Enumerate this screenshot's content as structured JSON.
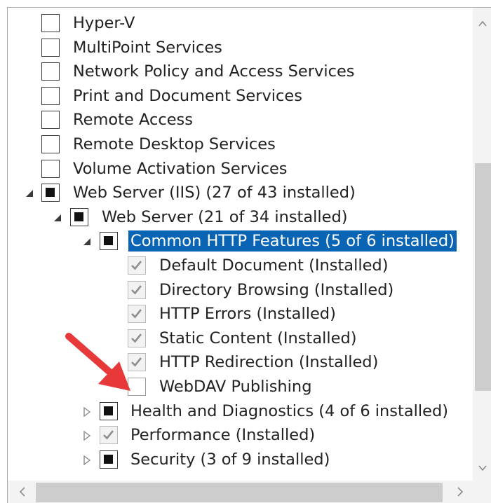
{
  "tree": {
    "rows": [
      {
        "label": "Hyper-V",
        "state": "unchecked",
        "disabled": false,
        "expander": "none",
        "level": 0,
        "selected": false
      },
      {
        "label": "MultiPoint Services",
        "state": "unchecked",
        "disabled": false,
        "expander": "none",
        "level": 0,
        "selected": false
      },
      {
        "label": "Network Policy and Access Services",
        "state": "unchecked",
        "disabled": false,
        "expander": "none",
        "level": 0,
        "selected": false
      },
      {
        "label": "Print and Document Services",
        "state": "unchecked",
        "disabled": false,
        "expander": "none",
        "level": 0,
        "selected": false
      },
      {
        "label": "Remote Access",
        "state": "unchecked",
        "disabled": false,
        "expander": "none",
        "level": 0,
        "selected": false
      },
      {
        "label": "Remote Desktop Services",
        "state": "unchecked",
        "disabled": false,
        "expander": "none",
        "level": 0,
        "selected": false
      },
      {
        "label": "Volume Activation Services",
        "state": "unchecked",
        "disabled": false,
        "expander": "none",
        "level": 0,
        "selected": false
      },
      {
        "label": "Web Server (IIS) (27 of 43 installed)",
        "state": "indeterminate",
        "disabled": false,
        "expander": "expanded",
        "level": 0,
        "selected": false
      },
      {
        "label": "Web Server (21 of 34 installed)",
        "state": "indeterminate",
        "disabled": false,
        "expander": "expanded",
        "level": 1,
        "selected": false
      },
      {
        "label": "Common HTTP Features (5 of 6 installed)",
        "state": "indeterminate",
        "disabled": false,
        "expander": "expanded",
        "level": 2,
        "selected": true
      },
      {
        "label": "Default Document (Installed)",
        "state": "checked",
        "disabled": true,
        "expander": "none",
        "level": 3,
        "selected": false
      },
      {
        "label": "Directory Browsing (Installed)",
        "state": "checked",
        "disabled": true,
        "expander": "none",
        "level": 3,
        "selected": false
      },
      {
        "label": "HTTP Errors (Installed)",
        "state": "checked",
        "disabled": true,
        "expander": "none",
        "level": 3,
        "selected": false
      },
      {
        "label": "Static Content (Installed)",
        "state": "checked",
        "disabled": true,
        "expander": "none",
        "level": 3,
        "selected": false
      },
      {
        "label": "HTTP Redirection (Installed)",
        "state": "checked",
        "disabled": true,
        "expander": "none",
        "level": 3,
        "selected": false
      },
      {
        "label": "WebDAV Publishing",
        "state": "unchecked",
        "disabled": true,
        "expander": "none",
        "level": 3,
        "selected": false
      },
      {
        "label": "Health and Diagnostics (4 of 6 installed)",
        "state": "indeterminate",
        "disabled": false,
        "expander": "collapsed",
        "level": 2,
        "selected": false
      },
      {
        "label": "Performance (Installed)",
        "state": "checked",
        "disabled": true,
        "expander": "collapsed",
        "level": 2,
        "selected": false
      },
      {
        "label": "Security (3 of 9 installed)",
        "state": "indeterminate",
        "disabled": false,
        "expander": "collapsed",
        "level": 2,
        "selected": false
      }
    ]
  },
  "icons": {
    "expanded": "triangle-down-right-icon",
    "collapsed": "triangle-right-outline-icon",
    "checked": "checkmark-icon",
    "annotation": "red-arrow-icon"
  },
  "colors": {
    "selection": "#0a64b4",
    "annotation_arrow": "#e8393a"
  }
}
